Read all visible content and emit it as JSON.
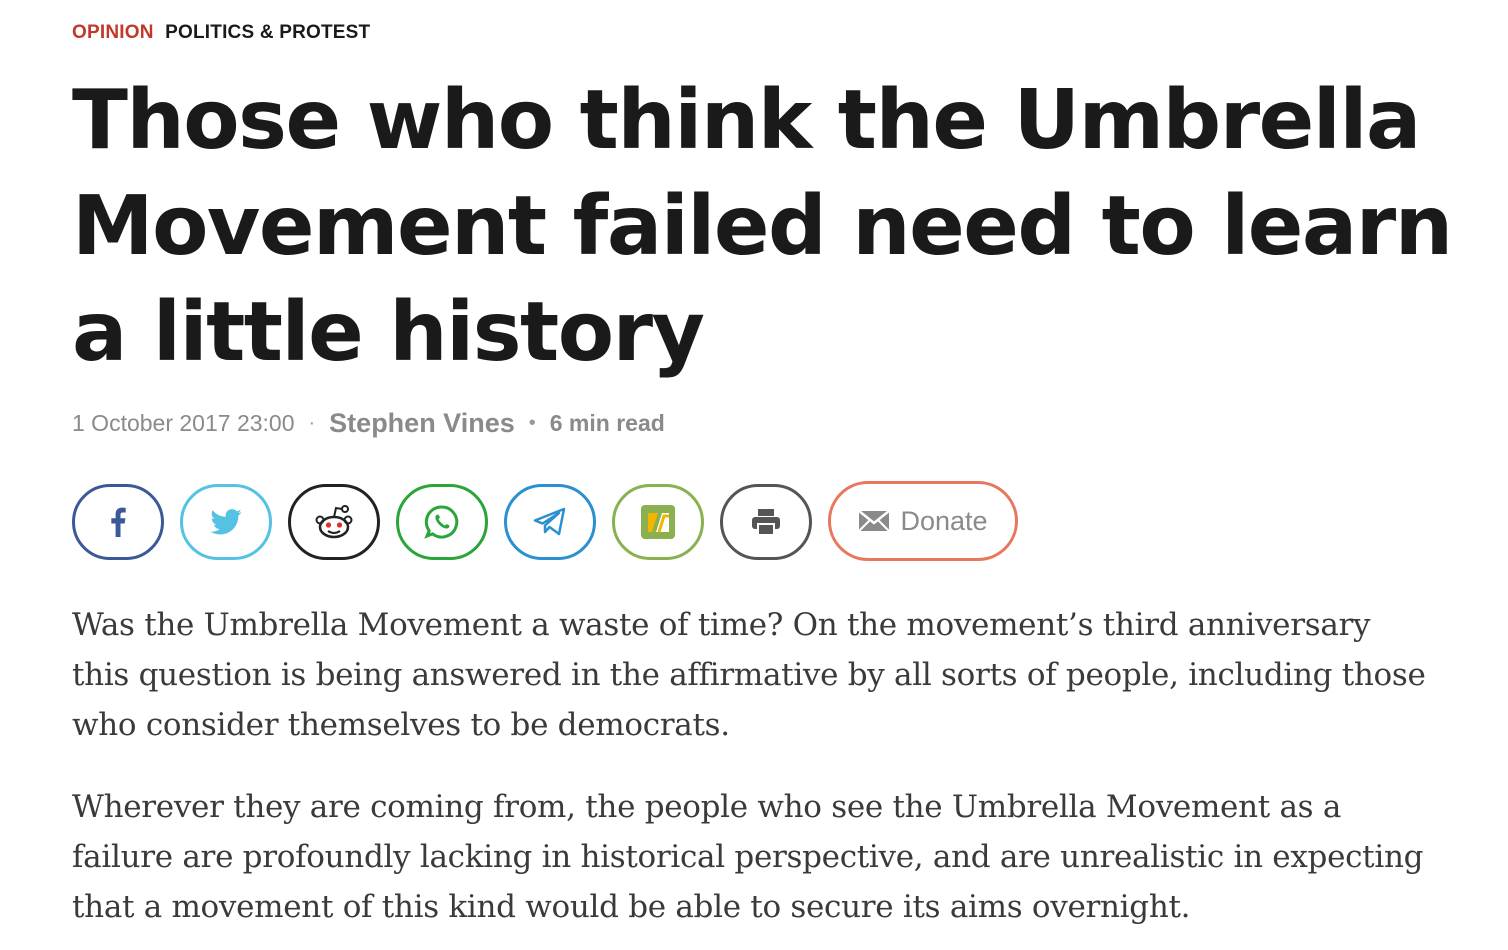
{
  "kicker": {
    "section": "OPINION",
    "category": "POLITICS & PROTEST"
  },
  "headline": "Those who think the Umbrella Movement failed need to learn a little history",
  "meta": {
    "date": "1 October 2017 23:00",
    "separator": "·",
    "author": "Stephen Vines",
    "separator2": "•",
    "read_time": "6 min read"
  },
  "share": {
    "buttons": [
      {
        "name": "facebook",
        "icon": "facebook-icon",
        "color": "#3b5998"
      },
      {
        "name": "twitter",
        "icon": "twitter-icon",
        "color": "#55c1e3"
      },
      {
        "name": "reddit",
        "icon": "reddit-icon",
        "color": "#222222"
      },
      {
        "name": "whatsapp",
        "icon": "whatsapp-icon",
        "color": "#2aa53a"
      },
      {
        "name": "telegram",
        "icon": "telegram-icon",
        "color": "#2a90d0"
      },
      {
        "name": "hkfp",
        "icon": "hkfp-icon",
        "color": "#8ab04f"
      },
      {
        "name": "print",
        "icon": "print-icon",
        "color": "#555555"
      }
    ],
    "donate_label": "Donate",
    "donate_icon": "envelope-icon",
    "donate_color": "#e8775e"
  },
  "body": {
    "paragraphs": [
      "Was the Umbrella Movement a waste of time? On the movement’s third anniversary this question is being answered in the affirmative by all sorts of people, including those who consider themselves to be democrats.",
      "Wherever they are coming from, the people who see the Umbrella Movement as a failure are profoundly lacking in historical perspective, and are unrealistic in expecting that a movement of this kind would be able to secure its aims overnight."
    ]
  },
  "colors": {
    "accent": "#c0392b",
    "text": "#1a1a1a",
    "meta": "#8a8a8a"
  }
}
